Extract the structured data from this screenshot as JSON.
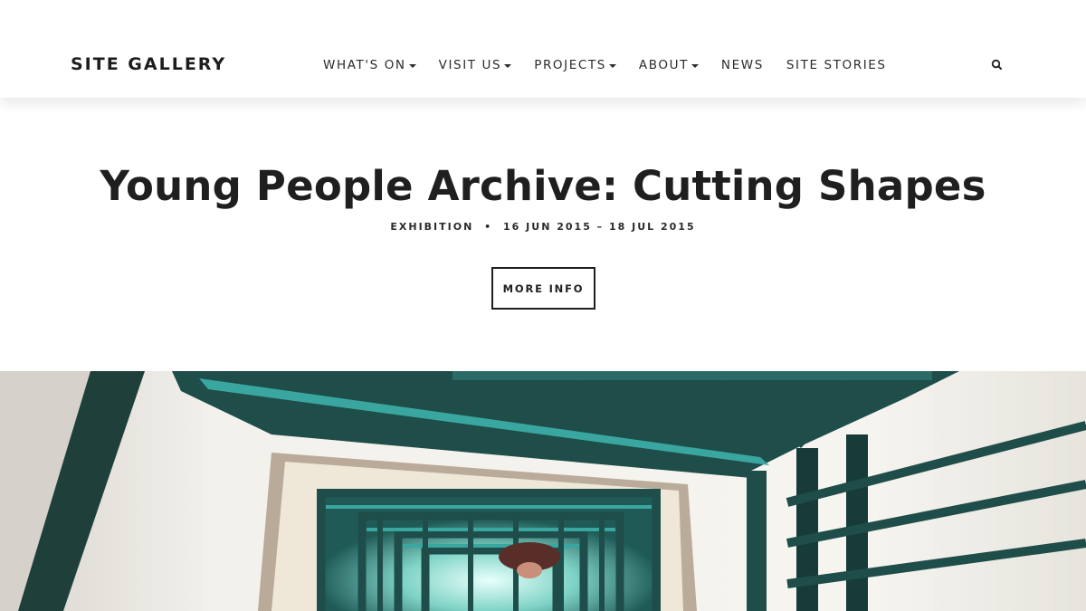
{
  "header": {
    "logo": "SITE GALLERY",
    "nav": [
      {
        "label": "WHAT'S ON",
        "has_dropdown": true
      },
      {
        "label": "VISIT US",
        "has_dropdown": true
      },
      {
        "label": "PROJECTS",
        "has_dropdown": true
      },
      {
        "label": "ABOUT",
        "has_dropdown": true
      },
      {
        "label": "NEWS",
        "has_dropdown": false
      },
      {
        "label": "SITE STORIES",
        "has_dropdown": false
      }
    ],
    "search_icon": "search-icon"
  },
  "hero": {
    "title": "Young People Archive: Cutting Shapes",
    "meta": {
      "type": "EXHIBITION",
      "separator": "•",
      "dates": "16 JUN 2015 – 18 JUL 2015"
    },
    "button_label": "MORE INFO",
    "image_description_colors": {
      "railing": "#1e4d4a",
      "railing_highlight": "#3aa6a0",
      "wall": "#f1eee8"
    }
  }
}
